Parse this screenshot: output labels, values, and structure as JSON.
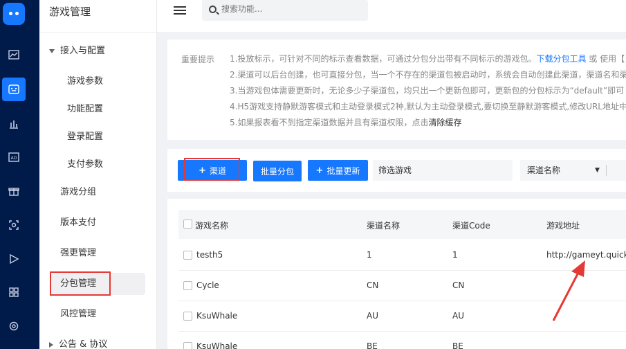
{
  "rail": {
    "icons": [
      "logo-icon",
      "line-chart-icon",
      "game-icon",
      "bar-chart-icon",
      "ad-icon",
      "gift-icon",
      "scan-icon",
      "play-icon",
      "grid-icon",
      "gear-icon"
    ]
  },
  "menu": {
    "title": "游戏管理",
    "group1": "接入与配置",
    "sub_items": [
      "游戏参数",
      "功能配置",
      "登录配置",
      "支付参数"
    ],
    "items": [
      "游戏分组",
      "版本支付",
      "强更管理",
      "分包管理",
      "风控管理"
    ],
    "group2": "公告 & 协议"
  },
  "topbar": {
    "search_placeholder": "搜索功能..."
  },
  "notice": {
    "label": "重要提示",
    "line1_text": "1.投放标示，可针对不同的标示查看数据，可通过分包分出带有不同标示的游戏包。",
    "line1_link": "下载分包工具",
    "line1_tail": " 或 使用【",
    "line2": "2.渠道可以后台创建，也可直接分包，当一个不存在的渠道包被启动时，系统会自动创建此渠道，渠道名和渠",
    "line3": "3.当游戏包体需要更新时，无论多少子渠道包，均只出一个更新包即可，更新包的分包标示为“default”即可",
    "line4": "4.H5游戏支持静默游客模式和主动登录模式2种,默认为主动登录模式,要切换至静默游客模式,修改URL地址中的",
    "line5_text": "5.如果报表看不到指定渠道数据并且有渠道权限，点击",
    "line5_bold": "清除缓存"
  },
  "toolbar": {
    "add_channel": "渠道",
    "batch_package": "批量分包",
    "batch_update": "批量更新",
    "filter_game": "筛选游戏",
    "channel_name": "渠道名称"
  },
  "table": {
    "headers": [
      "游戏名称",
      "渠道名称",
      "渠道Code",
      "游戏地址"
    ],
    "rows": [
      [
        "testh5",
        "1",
        "1",
        "http://gameyt.quicks"
      ],
      [
        "Cycle",
        "CN",
        "CN",
        ""
      ],
      [
        "KsuWhale",
        "AU",
        "AU",
        ""
      ],
      [
        "KsuWhale",
        "BE",
        "BE",
        ""
      ]
    ]
  },
  "colors": {
    "rail_bg": "#001a49",
    "accent": "#1677ff",
    "highlight": "#e53935"
  }
}
